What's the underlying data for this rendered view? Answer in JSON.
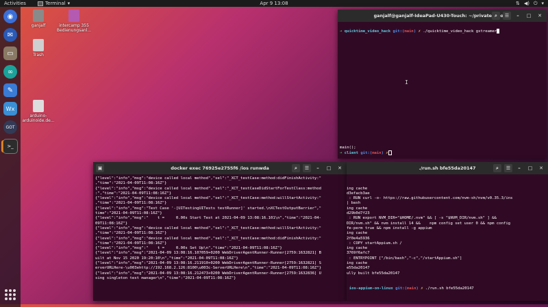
{
  "topbar": {
    "activities": "Activities",
    "app_name": "Terminal",
    "app_arrow": "▾",
    "clock": "Apr 9  13:08",
    "tray_icons": [
      "network-icon",
      "volume-icon",
      "power-icon"
    ],
    "tray_arrow": "▾"
  },
  "dock": {
    "items": [
      {
        "name": "chromium",
        "color": "#3b6fd8"
      },
      {
        "name": "thunderbird",
        "color": "#2a5ab5"
      },
      {
        "name": "files",
        "color": "#7a6a55"
      },
      {
        "name": "arduino",
        "color": "#1aa39a"
      },
      {
        "name": "text-editor",
        "color": "#3a7bd5"
      },
      {
        "name": "wx-app",
        "color": "#3a8fd5"
      },
      {
        "name": "godot",
        "color": "#333a55"
      },
      {
        "name": "terminal",
        "color": "#2c2c2c"
      }
    ]
  },
  "desktop": {
    "icons": [
      {
        "label": "ganjalf",
        "color": "#8a8a8a"
      },
      {
        "label": "intercamp 355",
        "label2": "Bedienungsanl...",
        "color": "#b45ab0"
      },
      {
        "label": "Trash",
        "color": "#cfcfcf"
      },
      {
        "label": "arduino-",
        "label2": "arduinoide.de...",
        "color": "#dddddd"
      }
    ]
  },
  "win_top": {
    "title": "ganjalf@ganjalf-IdeaPad-U430-Touch: ~/privaterepos/quickti...",
    "prompt_dir": "quicktime_video_hack",
    "git": "git:(",
    "branch": "main",
    "git_close": ")",
    "x": "✗",
    "command": "./quicktime_video_hack gstreamer",
    "partial": "main();",
    "prompt2_dir": "client",
    "prompt_arrow": "➜"
  },
  "win_left": {
    "title": "docker exec 76925e2755f6 /ios runwda",
    "lines": [
      "{\"level\":\"info\",\"msg\":\"device called local method\",\"sel\":\"_XCT_testCase:method:didFinishActivity:\"",
      ",\"time\":\"2021-04-09T11:08:16Z\"}",
      "{\"level\":\"info\",\"msg\":\"device called local method\",\"sel\":\"_XCT_testCaseDidStartForTestClass:method",
      ":\",\"time\":\"2021-04-09T11:08:16Z\"}",
      "{\"level\":\"info\",\"msg\":\"device called local method\",\"sel\":\"_XCT_testCase:method:willStartActivity:\"",
      ",\"time\":\"2021-04-09T11:08:16Z\"}",
      "{\"level\":\"info\",\"msg\":\"Test Case '-[UITestingUITests testRunner]' started.\\nXCTestOutputBarrier\",\"",
      "time\":\"2021-04-09T11:08:16Z\"}",
      "{\"level\":\"info\",\"msg\":\"    t =     0.00s Start Test at 2021-04-09 13:08:16.101\\n\",\"time\":\"2021-04-",
      "09T11:08:16Z\"}",
      "{\"level\":\"info\",\"msg\":\"device called local method\",\"sel\":\"_XCT_testCase:method:willStartActivity:\"",
      ",\"time\":\"2021-04-09T11:08:16Z\"}",
      "{\"level\":\"info\",\"msg\":\"device called local method\",\"sel\":\"_XCT_testCase:method:didFinishActivity:\"",
      ",\"time\":\"2021-04-09T11:08:16Z\"}",
      "{\"level\":\"info\",\"msg\":\"    t =     0.00s Set Up\\n\",\"time\":\"2021-04-09T11:08:16Z\"}",
      "{\"level\":\"info\",\"msg\":\"2021-04-09 13:08:16.107059+0200 WebDriverAgentRunner-Runner[2759:1632821] B",
      "uilt at Nov 15 2020 19:20:10\\n\",\"time\":\"2021-04-09T11:08:16Z\"}",
      "{\"level\":\"info\",\"msg\":\"2021-04-09 13:08:16.211910+0200 WebDriverAgentRunner-Runner[2759:1632821] S",
      "erverURLHere-\\u003ehttp://192.168.2.126:8100\\u003c-ServerURLHere\\n\",\"time\":\"2021-04-09T11:08:16Z\"}",
      "{\"level\":\"info\",\"msg\":\"2021-04-09 13:08:16.212473+0200 WebDriverAgentRunner-Runner[2759:1632836] U",
      "sing singleton test manager\\n\",\"time\":\"2021-04-09T11:08:16Z\"}"
    ]
  },
  "win_right": {
    "title": "./run.sh bfe55da20147",
    "lines": [
      " ---> Using cache",
      " ---> f9d3efacb3ae",
      "Step 5/8 : RUN curl -o- https://raw.githubusercontent.com/nvm-sh/nvm/v0.35.3/ins",
      "tall.sh | bash",
      " ---> Using cache",
      " ---> 3fd29b0d7f23",
      "Step 6/8 : RUN export NVM_DIR=\"$HOME/.nvm\" && [ -s \"$NVM_DIR/nvm.sh\" ] &&",
      ". \"$NVM_DIR/nvm.sh\" && nvm install 14 &&    npm config set user 0 && npm config",
      "set unsafe-perm true && npm install -g appium",
      " ---> Using cache",
      " ---> c42f0e4a5936",
      "Step 7/8 : COPY startAppium.sh /",
      " ---> Using cache",
      " ---> fc3769f6afc7",
      "Step 8/8 : ENTRYPOINT [\"/bin/bash\",\"-c\",\"/startAppium.sh\"]",
      " ---> Using cache",
      " ---> bfe55da20147",
      "Successfully built bfe55da20147"
    ],
    "prompt_dir": "ios-appium-on-linux",
    "branch": "main",
    "command": "./run.sh bfe55da20147",
    "tail_lines": [
      "{\"level\":\"info\",\"msg\":\"Start listening on port 7777 forwarding to port 8100 on d",
      "evice\",\"time\":\"2021-04-09T11:07:39Z\"}",
      "[Appium] Welcome to Appium v1.20.2",
      "[Appium] Appium REST http interface listener started on 0.0.0.0:4723"
    ]
  }
}
